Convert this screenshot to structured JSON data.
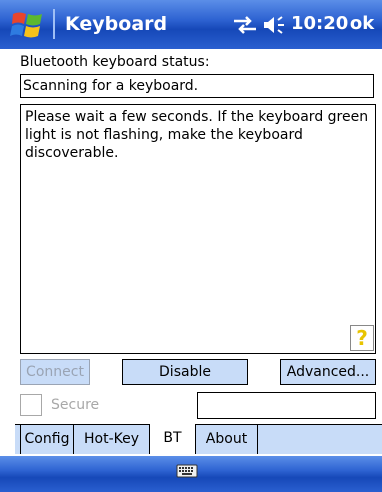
{
  "titlebar": {
    "title": "Keyboard",
    "clock": "10:20",
    "ok_label": "ok",
    "accent_color": "#2e63d2"
  },
  "status": {
    "label": "Bluetooth keyboard status:",
    "value": "Scanning for a keyboard."
  },
  "message": {
    "text": "Please wait a few seconds. If the keyboard green light is not flashing, make the keyboard discoverable.",
    "help_glyph": "?"
  },
  "buttons": {
    "connect": "Connect",
    "disable": "Disable",
    "advanced": "Advanced..."
  },
  "secure": {
    "label": "Secure",
    "checked": false,
    "field_value": ""
  },
  "tabs": [
    {
      "label": "Config",
      "active": false
    },
    {
      "label": "Hot-Key",
      "active": false
    },
    {
      "label": "BT",
      "active": true
    },
    {
      "label": "About",
      "active": false
    }
  ],
  "icons": {
    "start": "windows-flag-icon",
    "connectivity": "connectivity-icon",
    "volume": "volume-icon",
    "help": "help-icon",
    "input": "keyboard-icon"
  }
}
